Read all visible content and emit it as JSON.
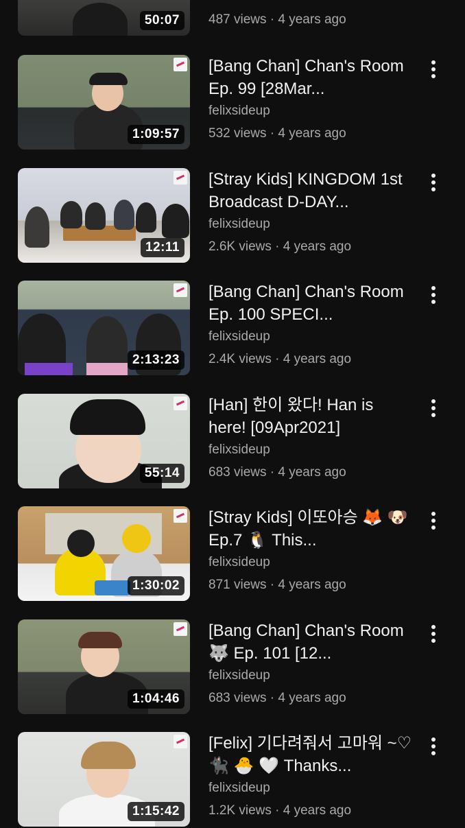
{
  "videos": [
    {
      "title": "",
      "channel": "",
      "views": "487 views",
      "age": "4 years ago",
      "duration": "50:07"
    },
    {
      "title": "[Bang Chan] Chan's Room Ep. 99 [28Mar...",
      "channel": "felixsideup",
      "views": "532 views",
      "age": "4 years ago",
      "duration": "1:09:57"
    },
    {
      "title": "[Stray Kids] KINGDOM 1st Broadcast D-DAY...",
      "channel": "felixsideup",
      "views": "2.6K views",
      "age": "4 years ago",
      "duration": "12:11"
    },
    {
      "title": "[Bang Chan] Chan's Room Ep. 100 SPECI...",
      "channel": "felixsideup",
      "views": "2.4K views",
      "age": "4 years ago",
      "duration": "2:13:23"
    },
    {
      "title": "[Han] 한이 왔다! Han is here! [09Apr2021]",
      "channel": "felixsideup",
      "views": "683 views",
      "age": "4 years ago",
      "duration": "55:14"
    },
    {
      "title": "[Stray Kids] 이또아승 🦊 🐶 Ep.7 🐧 This...",
      "channel": "felixsideup",
      "views": "871 views",
      "age": "4 years ago",
      "duration": "1:30:02"
    },
    {
      "title": "[Bang Chan] Chan's Room 🐺 Ep. 101 [12...",
      "channel": "felixsideup",
      "views": "683 views",
      "age": "4 years ago",
      "duration": "1:04:46"
    },
    {
      "title": "[Felix] 기다려줘서 고마워 ~♡ 🐈‍⬛ 🐣 🤍 Thanks...",
      "channel": "felixsideup",
      "views": "1.2K views",
      "age": "4 years ago",
      "duration": "1:15:42"
    }
  ],
  "separator": " · ",
  "icons": {
    "menu": "more-vert-icon",
    "watermark": "channel-logo-icon"
  }
}
